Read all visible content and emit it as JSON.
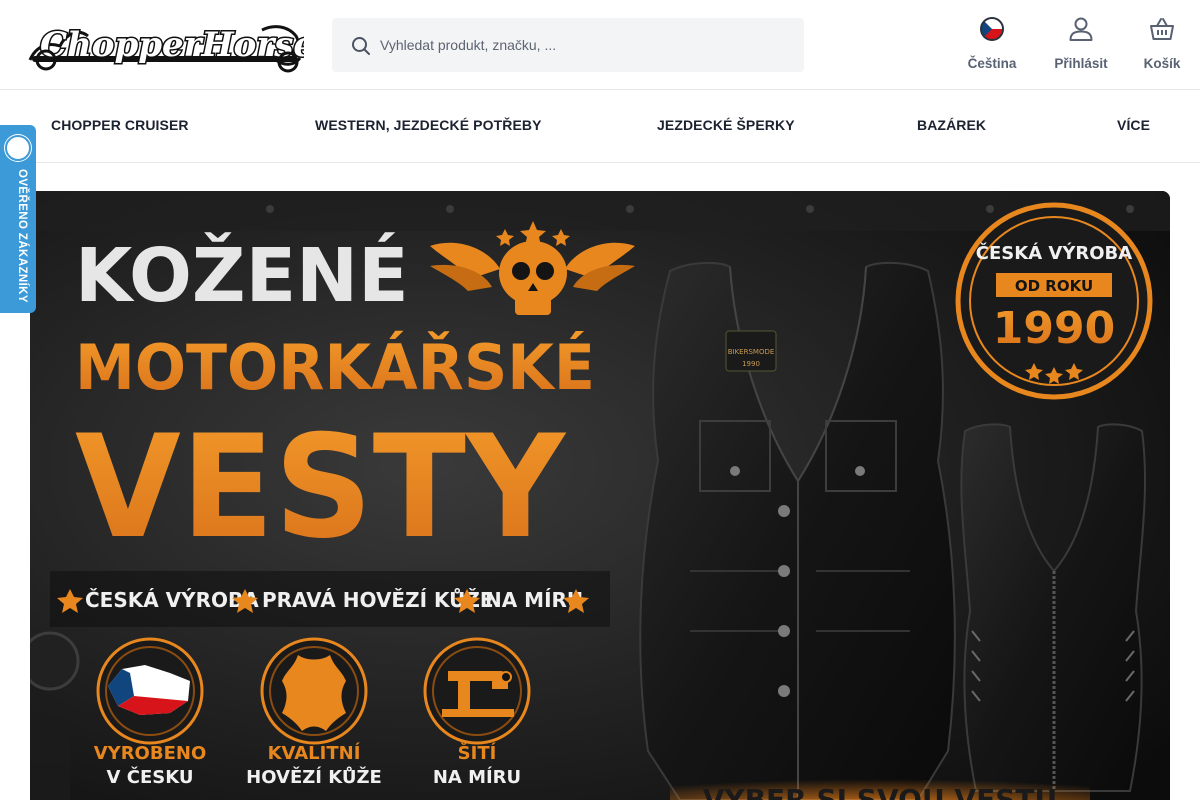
{
  "brand": {
    "logo_text": "ChopperHorse"
  },
  "search": {
    "placeholder": "Vyhledat produkt, značku, ..."
  },
  "header_actions": {
    "language": "Čeština",
    "login": "Přihlásit",
    "cart": "Košík"
  },
  "nav": {
    "items": [
      {
        "label": "CHOPPER CRUISER"
      },
      {
        "label": "WESTERN, JEZDECKÉ POTŘEBY"
      },
      {
        "label": "JEZDECKÉ ŠPERKY"
      },
      {
        "label": "BAZÁREK"
      },
      {
        "label": "VÍCE"
      }
    ]
  },
  "verified_badge": {
    "text": "OVĚŘENO ZÁKAZNÍKY"
  },
  "banner": {
    "headline_1": "KOŽENÉ",
    "headline_2": "MOTORKÁŘSKÉ",
    "headline_3": "VESTY",
    "features_line": [
      "ČESKÁ VÝROBA",
      "PRAVÁ HOVĚZÍ KŮŽE",
      "NA MÍRU"
    ],
    "icons": [
      {
        "line1": "VYROBENO",
        "line2": "V ČESKU",
        "icon": "czech-map-icon"
      },
      {
        "line1": "KVALITNÍ",
        "line2": "HOVĚZÍ KŮŽE",
        "icon": "leather-hide-icon"
      },
      {
        "line1": "ŠITÍ",
        "line2": "NA MÍRU",
        "icon": "sewing-machine-icon"
      }
    ],
    "seal": {
      "top": "ČESKÁ VÝROBA",
      "middle": "OD ROKU",
      "year": "1990"
    },
    "cta_partial": "VYBER SI SVOU VESTU",
    "vest_label": "BIKERSMODE",
    "vest_year": "1990",
    "accent_color": "#e8871e"
  }
}
